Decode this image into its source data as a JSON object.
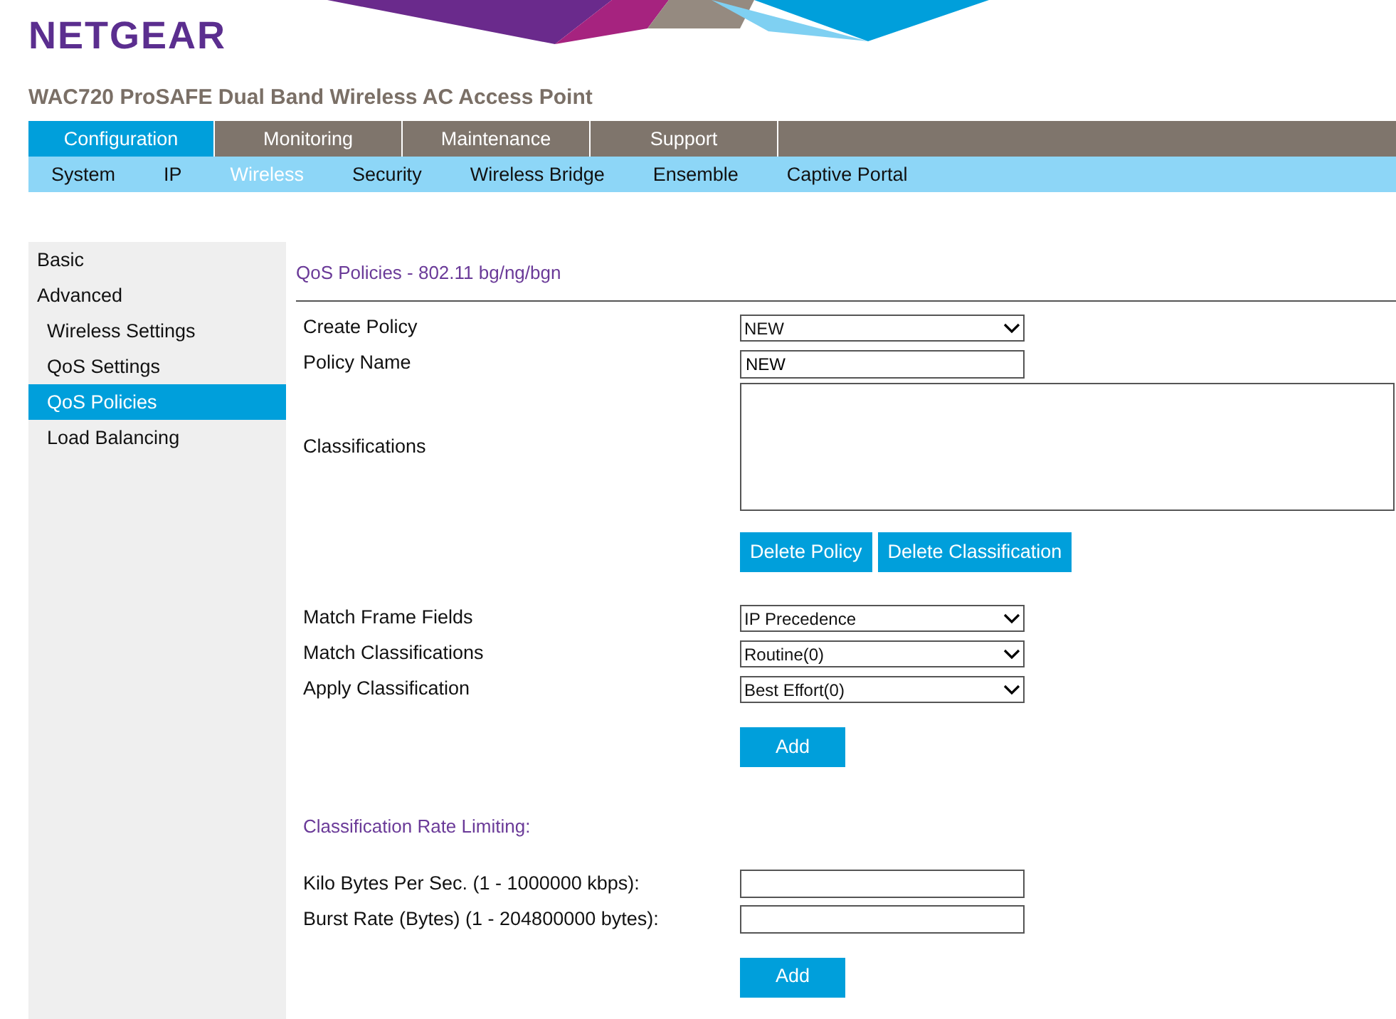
{
  "logo": "NETGEAR",
  "product_title": "WAC720 ProSAFE Dual Band Wireless AC Access Point",
  "main_tabs": [
    {
      "label": "Configuration",
      "selected": true
    },
    {
      "label": "Monitoring",
      "selected": false
    },
    {
      "label": "Maintenance",
      "selected": false
    },
    {
      "label": "Support",
      "selected": false
    }
  ],
  "sub_tabs": [
    {
      "label": "System",
      "selected": false
    },
    {
      "label": "IP",
      "selected": false
    },
    {
      "label": "Wireless",
      "selected": true
    },
    {
      "label": "Security",
      "selected": false
    },
    {
      "label": "Wireless Bridge",
      "selected": false
    },
    {
      "label": "Ensemble",
      "selected": false
    },
    {
      "label": "Captive Portal",
      "selected": false
    }
  ],
  "sidebar": {
    "items": [
      {
        "label": "Basic",
        "selected": false
      },
      {
        "label": "Advanced",
        "selected": false,
        "children": [
          {
            "label": "Wireless Settings",
            "selected": false
          },
          {
            "label": "QoS Settings",
            "selected": false
          },
          {
            "label": "QoS Policies",
            "selected": true
          },
          {
            "label": "Load Balancing",
            "selected": false
          }
        ]
      }
    ]
  },
  "section_title": "QoS Policies - 802.11 bg/ng/bgn",
  "form": [
    {
      "kind": "select",
      "label": "Create Policy",
      "value": "NEW"
    },
    {
      "kind": "text",
      "label": "Policy Name",
      "value": "NEW"
    },
    {
      "kind": "textarea",
      "label": "Classifications"
    },
    {
      "kind": "buttons",
      "buttons": [
        "Delete Policy",
        "Delete Classification"
      ]
    },
    {
      "kind": "select",
      "label": "Match Frame Fields",
      "value": "IP Precedence"
    },
    {
      "kind": "select",
      "label": "Match Classifications",
      "value": "Routine(0)"
    },
    {
      "kind": "select",
      "label": "Apply Classification",
      "value": "Best Effort(0)"
    },
    {
      "kind": "buttons",
      "buttons": [
        "Add"
      ]
    },
    {
      "kind": "heading",
      "text": "Classification Rate Limiting:"
    },
    {
      "kind": "text",
      "label": "Kilo Bytes Per Sec. (1 - 1000000 kbps):"
    },
    {
      "kind": "text",
      "label": "Burst Rate (Bytes) (1 - 204800000 bytes):"
    },
    {
      "kind": "buttons",
      "buttons": [
        "Add"
      ]
    }
  ]
}
